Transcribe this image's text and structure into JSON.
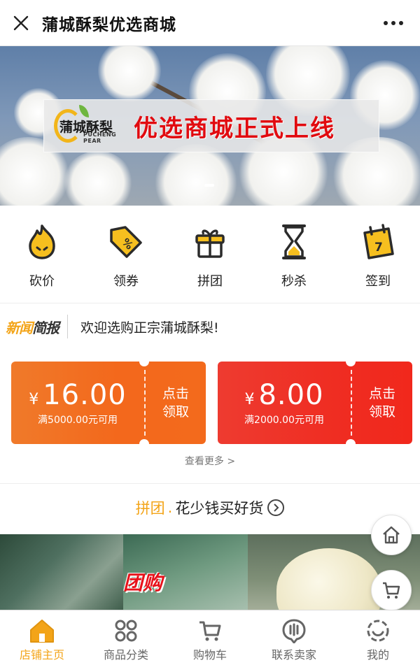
{
  "topbar": {
    "title": "蒲城酥梨优选商城",
    "close_icon": "close-icon",
    "more_icon": "more-dots-icon"
  },
  "banner": {
    "logo_cn": "蒲城酥梨",
    "logo_en": "PUCHENG PEAR",
    "slogan": "优选商城正式上线"
  },
  "quicknav": [
    {
      "label": "砍价",
      "icon": "fire-icon"
    },
    {
      "label": "领券",
      "icon": "coupon-tag-icon"
    },
    {
      "label": "拼团",
      "icon": "gift-icon"
    },
    {
      "label": "秒杀",
      "icon": "hourglass-icon"
    },
    {
      "label": "签到",
      "icon": "calendar-icon"
    }
  ],
  "news": {
    "logo_a": "新闻",
    "logo_b": "简报",
    "text": "欢迎选购正宗蒲城酥梨!"
  },
  "coupons": [
    {
      "currency": "¥",
      "value": "16.00",
      "condition": "满5000.00元可用",
      "action_line1": "点击",
      "action_line2": "领取"
    },
    {
      "currency": "¥",
      "value": "8.00",
      "condition": "满2000.00元可用",
      "action_line1": "点击",
      "action_line2": "领取"
    }
  ],
  "more_link": "查看更多 >",
  "group_buy": {
    "title": "拼团",
    "dot": ".",
    "subtitle": "花少钱买好货"
  },
  "product_tag": "团购",
  "tabbar": [
    {
      "label": "店铺主页",
      "icon": "home-icon",
      "active": true
    },
    {
      "label": "商品分类",
      "icon": "category-icon",
      "active": false
    },
    {
      "label": "购物车",
      "icon": "cart-icon",
      "active": false
    },
    {
      "label": "联系卖家",
      "icon": "chat-icon",
      "active": false
    },
    {
      "label": "我的",
      "icon": "profile-icon",
      "active": false
    }
  ],
  "colors": {
    "accent": "#f3a418",
    "coupon_orange": "#f3681c",
    "coupon_red": "#ef2d22",
    "slogan_red": "#e10b10"
  }
}
